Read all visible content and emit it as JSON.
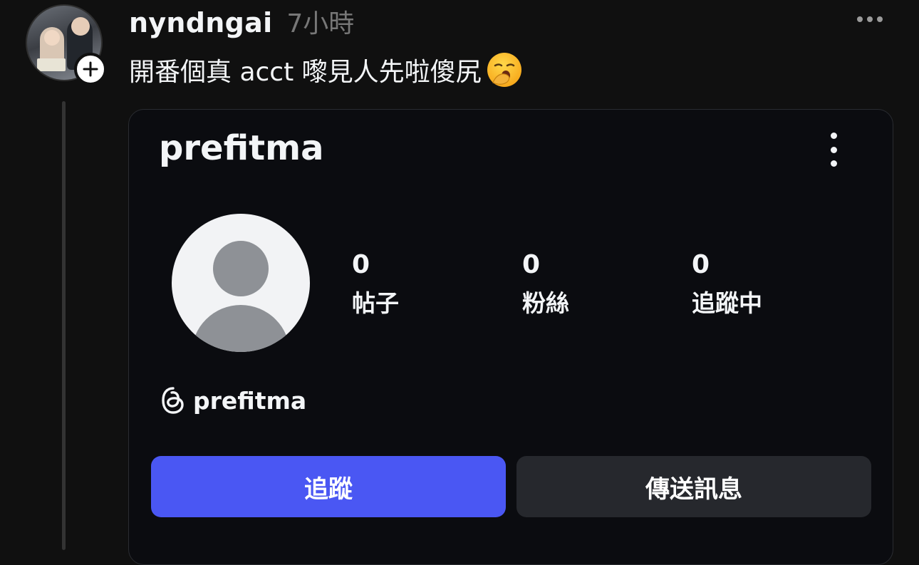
{
  "post": {
    "username": "nyndngai",
    "timestamp": "7小時",
    "text": "開番個真 acct 嚟見人先啦傻尻",
    "emoji": "yawning-face"
  },
  "card": {
    "handle": "prefitma",
    "stats": [
      {
        "value": "0",
        "label": "帖子"
      },
      {
        "value": "0",
        "label": "粉絲"
      },
      {
        "value": "0",
        "label": "追蹤中"
      }
    ],
    "threads_handle": "prefitma",
    "follow_label": "追蹤",
    "message_label": "傳送訊息"
  },
  "colors": {
    "background": "#101010",
    "card_background": "#0b0c10",
    "follow_button": "#4a57f3",
    "message_button": "#26282d",
    "timestamp": "#777777"
  }
}
